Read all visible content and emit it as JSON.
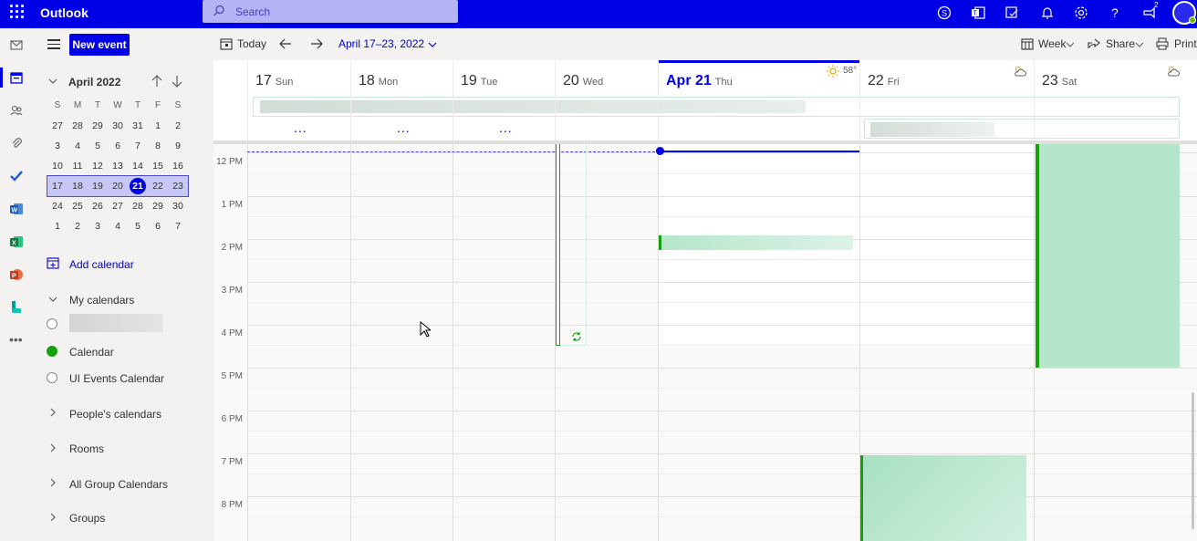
{
  "app": {
    "name": "Outlook"
  },
  "search": {
    "placeholder": "Search"
  },
  "topbar": {
    "notification_count": "2"
  },
  "toolbar": {
    "new_event": "New event",
    "today": "Today",
    "date_range": "April 17–23, 2022",
    "view": "Week",
    "share": "Share",
    "print": "Print"
  },
  "mini_calendar": {
    "month": "April 2022",
    "weekdays": [
      "S",
      "M",
      "T",
      "W",
      "T",
      "F",
      "S"
    ],
    "weeks": [
      [
        "27",
        "28",
        "29",
        "30",
        "31",
        "1",
        "2"
      ],
      [
        "3",
        "4",
        "5",
        "6",
        "7",
        "8",
        "9"
      ],
      [
        "10",
        "11",
        "12",
        "13",
        "14",
        "15",
        "16"
      ],
      [
        "17",
        "18",
        "19",
        "20",
        "21",
        "22",
        "23"
      ],
      [
        "24",
        "25",
        "26",
        "27",
        "28",
        "29",
        "30"
      ],
      [
        "1",
        "2",
        "3",
        "4",
        "5",
        "6",
        "7"
      ]
    ],
    "selected_week_index": 3,
    "today": "21"
  },
  "sidebar": {
    "add_calendar": "Add calendar",
    "my_calendars": "My calendars",
    "calendars": [
      {
        "label": "",
        "checked": false
      },
      {
        "label": "Calendar",
        "checked": true
      },
      {
        "label": "UI Events Calendar",
        "checked": false
      }
    ],
    "groups": [
      "People's calendars",
      "Rooms",
      "All Group Calendars",
      "Groups"
    ]
  },
  "days": [
    {
      "num": "17",
      "weekday": "Sun"
    },
    {
      "num": "18",
      "weekday": "Mon"
    },
    {
      "num": "19",
      "weekday": "Tue"
    },
    {
      "num": "20",
      "weekday": "Wed"
    },
    {
      "num": "Apr 21",
      "weekday": "Thu",
      "current": true,
      "weather": "58°"
    },
    {
      "num": "22",
      "weekday": "Fri"
    },
    {
      "num": "23",
      "weekday": "Sat"
    }
  ],
  "more_indicator": "...",
  "times": [
    "12 PM",
    "1 PM",
    "2 PM",
    "3 PM",
    "4 PM",
    "5 PM",
    "6 PM",
    "7 PM",
    "8 PM"
  ],
  "colors": {
    "brand": "#0000e6",
    "event_green": "#13a10e",
    "event_fill": "#b5e6cc"
  }
}
